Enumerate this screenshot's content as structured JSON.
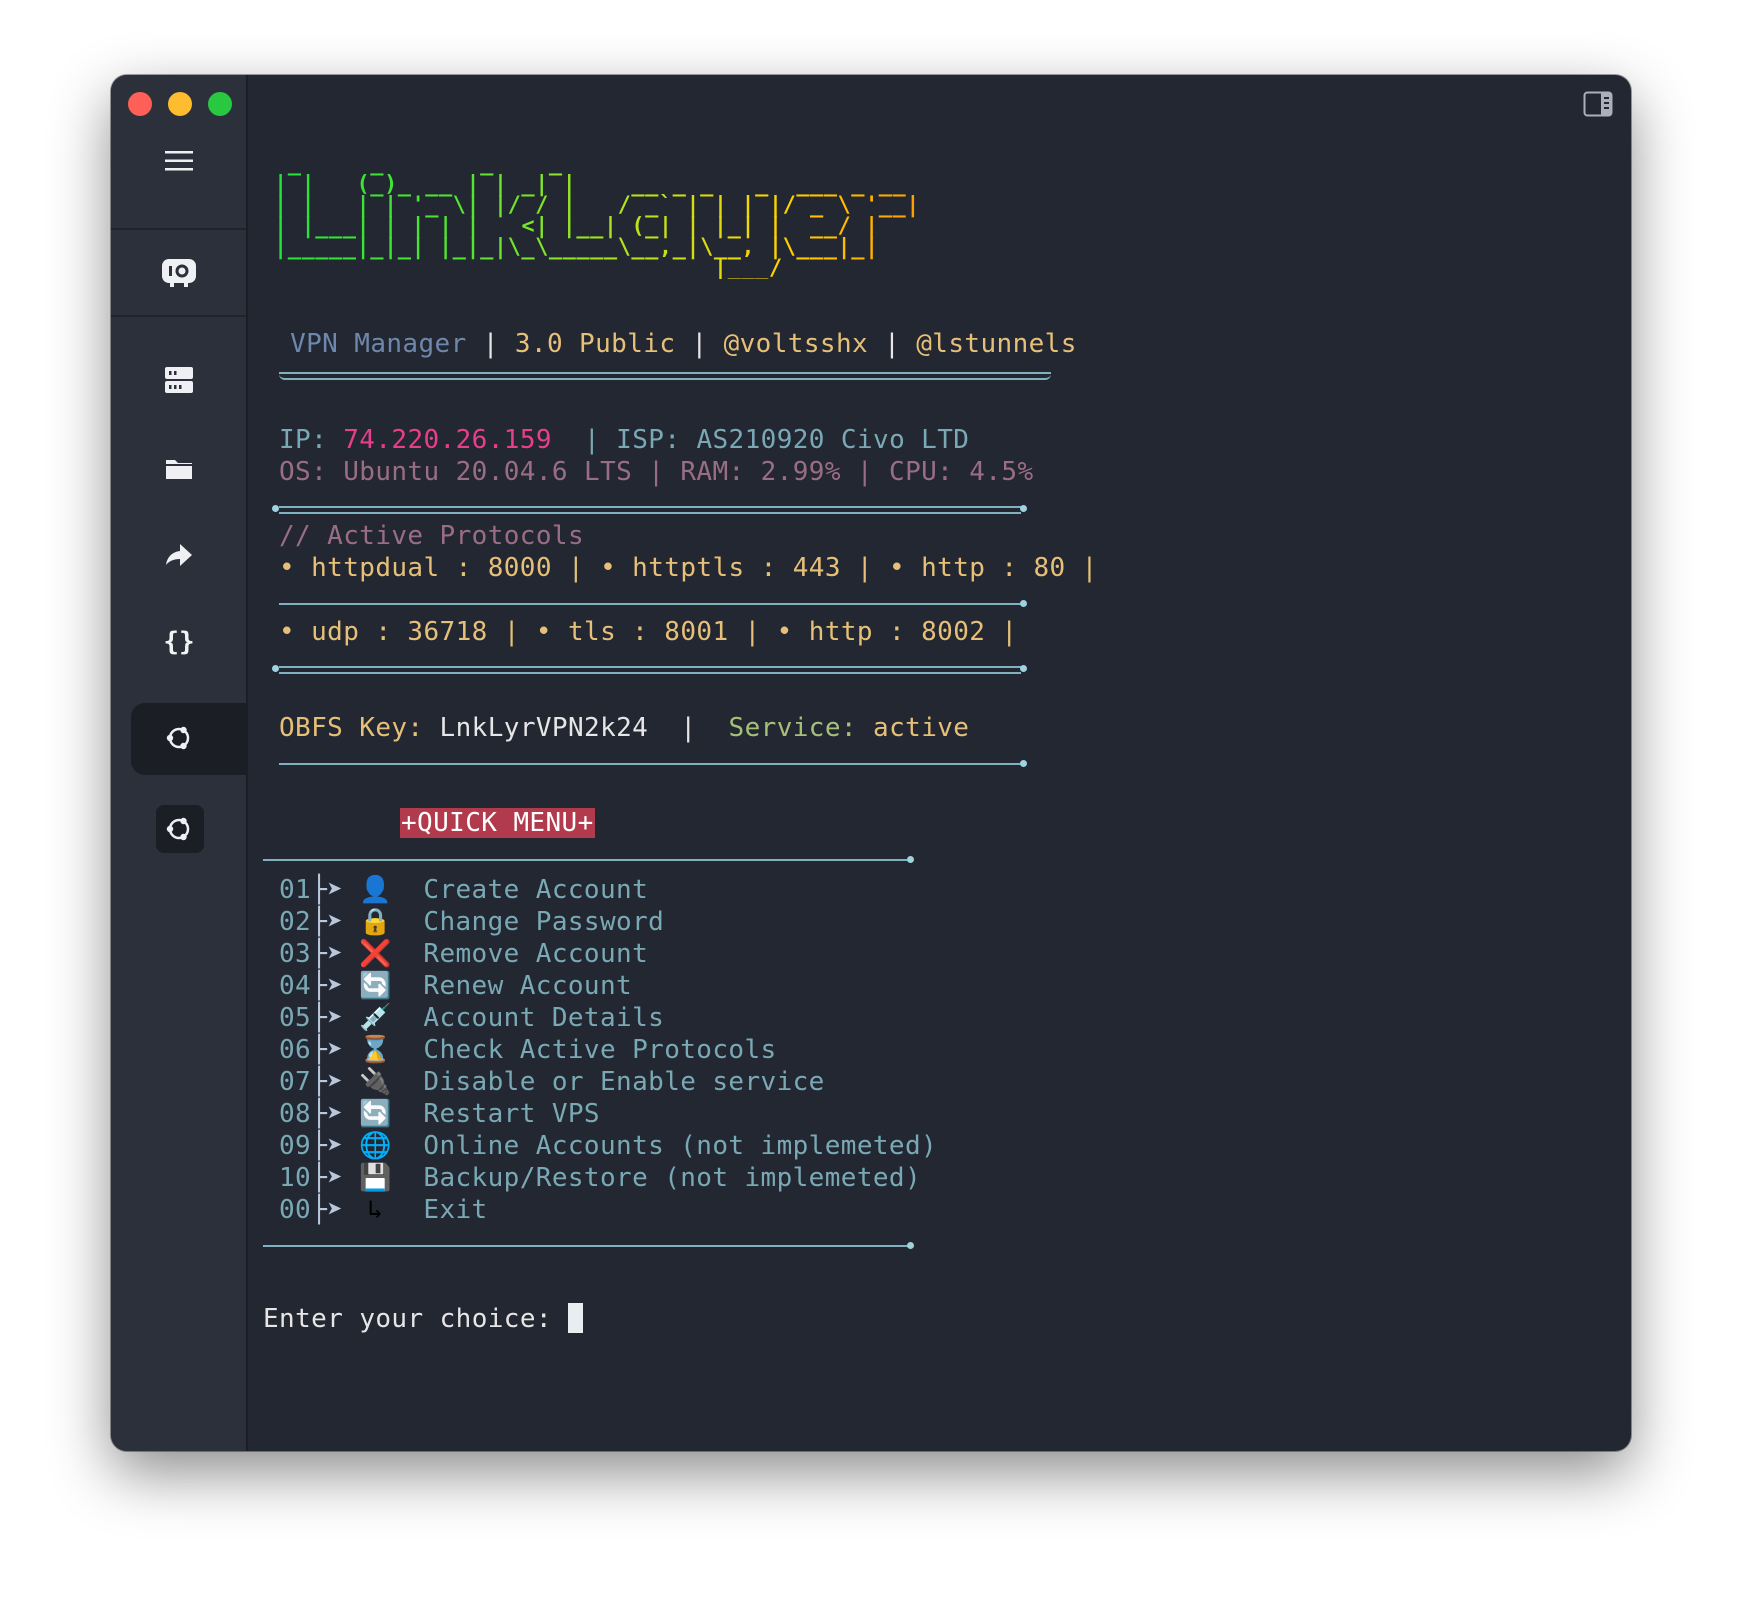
{
  "banner": {
    "ascii_lines": [
      " _     _       _    _                          ",
      "| |   (_)_ __ | | _| |    __ _ _   _  ___ _ __ ",
      "| |   | | '_ \\| |/ / |   / _` | | | |/ _ \\ '__|",
      "| |___| | | | |   <| |__| (_| | |_| |  __/ |   ",
      "|_____|_|_| |_|_|\\_\\_____\\__,_|\\__, |\\___|_|   ",
      "                                |___/          "
    ],
    "app_name": "VPN Manager",
    "version": "3.0 Public",
    "handle1": "@voltsshx",
    "handle2": "@lstunnels",
    "sep": "|"
  },
  "system": {
    "ip_label": "IP:",
    "ip": "74.220.26.159",
    "isp_label": "| ISP:",
    "isp": "AS210920 Civo LTD",
    "os_line": "OS: Ubuntu 20.04.6 LTS | RAM: 2.99% | CPU: 4.5%"
  },
  "protocols": {
    "comment": "// Active Protocols",
    "row1": "• httpdual : 8000 | • httptls : 443 | • http : 80 |",
    "row2": "• udp : 36718 | • tls : 8001 | • http : 8002 |"
  },
  "obfs": {
    "key_label": "OBFS Key:",
    "key": "LnkLyrVPN2k24",
    "sep": "|",
    "service_label": "Service:",
    "service_status": "active"
  },
  "quick_menu": {
    "title": "+QUICK MENU+",
    "items": [
      {
        "num": "01",
        "icon": "👤",
        "label": "Create Account"
      },
      {
        "num": "02",
        "icon": "🔒",
        "label": "Change Password"
      },
      {
        "num": "03",
        "icon": "❌",
        "label": "Remove Account"
      },
      {
        "num": "04",
        "icon": "🔄",
        "label": "Renew Account"
      },
      {
        "num": "05",
        "icon": "💉",
        "label": "Account Details"
      },
      {
        "num": "06",
        "icon": "⌛",
        "label": "Check Active Protocols"
      },
      {
        "num": "07",
        "icon": "🔌",
        "label": "Disable or Enable service"
      },
      {
        "num": "08",
        "icon": "🔄",
        "label": "Restart VPS"
      },
      {
        "num": "09",
        "icon": "🌐",
        "label": "Online Accounts (not implemeted)"
      },
      {
        "num": "10",
        "icon": "💾",
        "label": "Backup/Restore (not implemeted)"
      },
      {
        "num": "00",
        "icon": "↳",
        "label": "Exit"
      }
    ],
    "arrow": "├➤"
  },
  "prompt": {
    "text": "Enter your choice: "
  },
  "sidebar": {
    "icons": [
      "hamburger-menu-icon",
      "vpn-key-icon",
      "server-icon",
      "folder-icon",
      "share-arrow-icon",
      "braces-icon",
      "ubuntu-icon",
      "ubuntu-icon"
    ]
  },
  "colors": {
    "window_bg": "#232731",
    "sidebar_bg": "#2c303b",
    "accent_pink": "#e83e8c",
    "gold": "#e6c078",
    "menu_badge": "#b13b4d"
  }
}
